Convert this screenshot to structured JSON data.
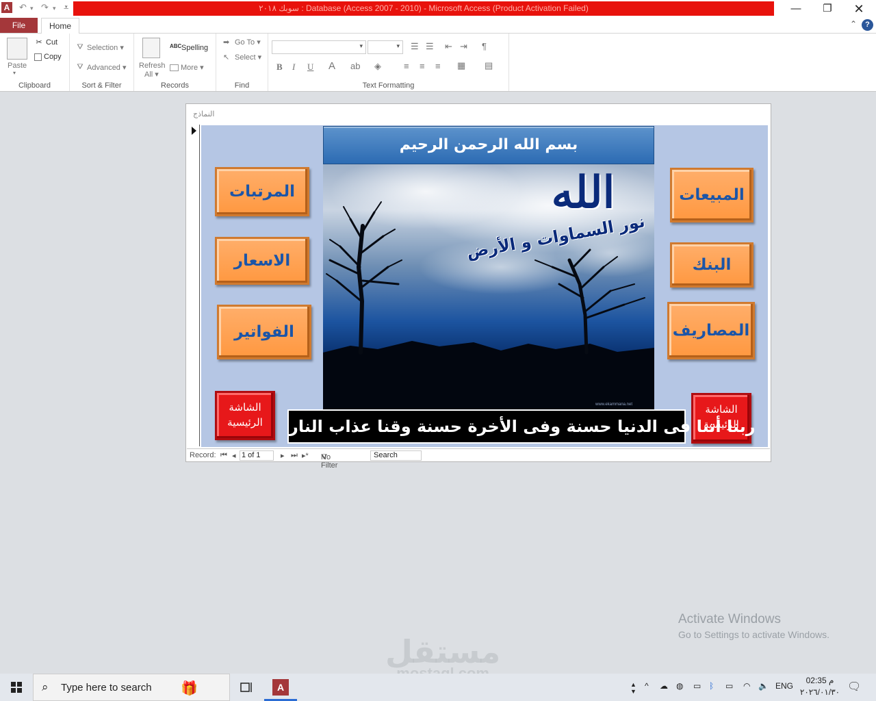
{
  "window": {
    "title": "سوبك ٢٠١٨ : Database (Access 2007 - 2010)  -  Microsoft Access (Product Activation Failed)",
    "app_icon_letter": "A"
  },
  "tabs": {
    "file": "File",
    "home": "Home"
  },
  "ribbon": {
    "clipboard": {
      "paste": "Paste",
      "cut": "Cut",
      "copy": "Copy",
      "label": "Clipboard"
    },
    "sort_filter": {
      "selection": "Selection",
      "advanced": "Advanced",
      "label": "Sort & Filter"
    },
    "records": {
      "refresh": "Refresh",
      "refresh_all": "All",
      "spelling": "Spelling",
      "more": "More",
      "label": "Records"
    },
    "find": {
      "goto": "Go To",
      "select": "Select",
      "label": "Find"
    },
    "text_formatting": {
      "bold": "B",
      "italic": "I",
      "underline": "U",
      "font_color": "A",
      "label": "Text Formatting"
    }
  },
  "form": {
    "tab_title": "النماذج",
    "banner": "بسم الله الرحمن الرحيم",
    "photo_caption_main": "الله",
    "photo_caption_sub": "نور السماوات و الأرض",
    "photo_watermark": "www.ekammana.net",
    "buttons": {
      "sales": "المبيعات",
      "bank": "البنك",
      "expenses": "المصاريف",
      "salaries": "المرتبات",
      "prices": "الاسعار",
      "invoices": "الفواتير",
      "home_left": "الشاشة الرئيسية",
      "home_right": "الشاشة الرئيسية"
    },
    "verse": "ربنا أتنا فى الدنيا حسنة  وفى الأخرة  حسنة وقنا عذاب النار"
  },
  "record_nav": {
    "label": "Record:",
    "current": "1 of 1",
    "filter": "No Filter",
    "search": "Search"
  },
  "watermark": {
    "activate_title": "Activate Windows",
    "activate_sub": "Go to Settings to activate Windows.",
    "mostaql_ar": "مستقل",
    "mostaql_en": "mostaql.com"
  },
  "taskbar": {
    "search_placeholder": "Type here to search",
    "lang": "ENG",
    "time": "02:35 م",
    "date": "٢٠٢٦/٠١/٣٠"
  },
  "colors": {
    "title_red": "#e8120c",
    "file_tab": "#a4373a",
    "orange_button": "#ff9840",
    "red_button": "#e7181a",
    "form_background": "#b5c6e4",
    "banner_blue": "#2c6bb3"
  }
}
